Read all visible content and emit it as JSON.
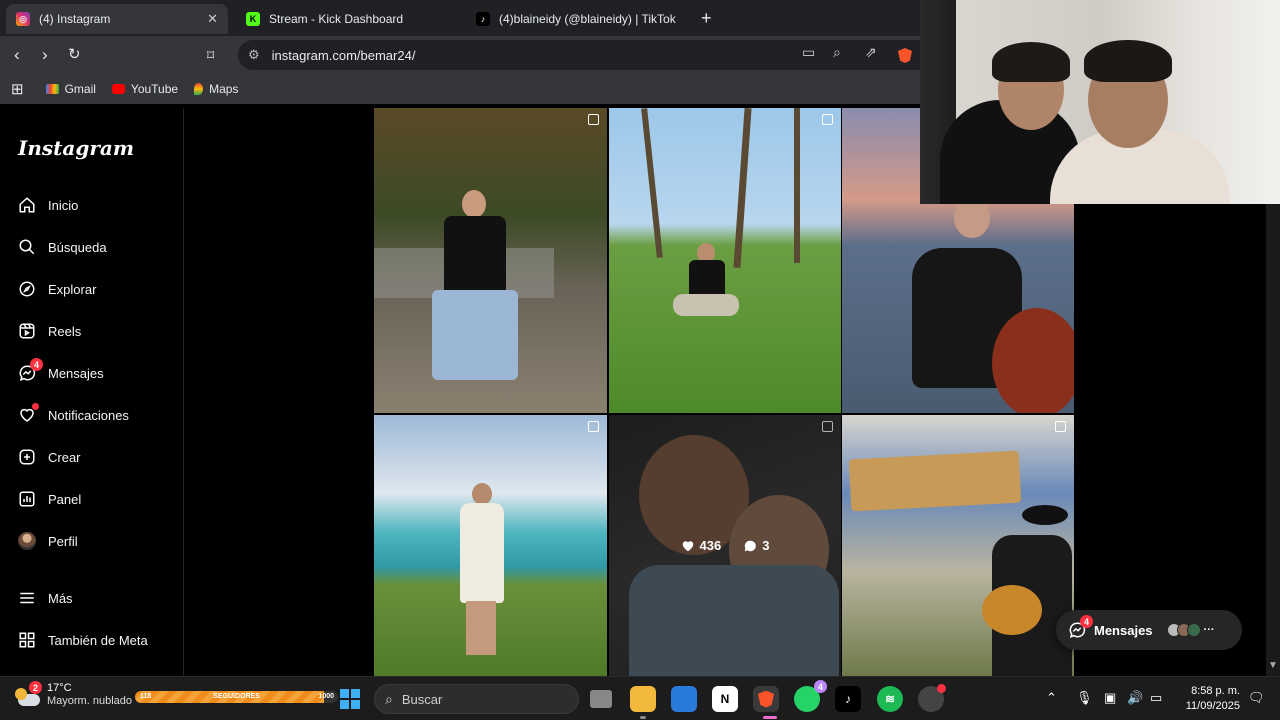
{
  "browser": {
    "tabs": [
      {
        "title": "(4) Instagram",
        "icon": "instagram-icon",
        "active": true
      },
      {
        "title": "Stream - Kick Dashboard",
        "icon": "kick-icon",
        "active": false
      },
      {
        "title": "(4)blaineidy (@blaineidy) | TikTok",
        "icon": "tiktok-icon",
        "active": false
      }
    ],
    "url": "instagram.com/bemar24/",
    "bookmarks": [
      {
        "label": "Gmail",
        "icon": "gmail-icon"
      },
      {
        "label": "YouTube",
        "icon": "youtube-icon"
      },
      {
        "label": "Maps",
        "icon": "maps-icon"
      }
    ]
  },
  "instagram": {
    "logo": "Instagram",
    "nav": [
      {
        "label": "Inicio",
        "icon": "home-icon"
      },
      {
        "label": "Búsqueda",
        "icon": "search-icon"
      },
      {
        "label": "Explorar",
        "icon": "compass-icon"
      },
      {
        "label": "Reels",
        "icon": "reels-icon"
      },
      {
        "label": "Mensajes",
        "icon": "messenger-icon",
        "badge": "4"
      },
      {
        "label": "Notificaciones",
        "icon": "heart-icon"
      },
      {
        "label": "Crear",
        "icon": "plus-square-icon"
      },
      {
        "label": "Panel",
        "icon": "chart-icon"
      },
      {
        "label": "Perfil",
        "icon": "avatar-icon"
      },
      {
        "label": "Más",
        "icon": "menu-icon"
      },
      {
        "label": "También de Meta",
        "icon": "meta-icon"
      }
    ],
    "hover_post": {
      "likes": "436",
      "comments": "3"
    },
    "messages_pill": {
      "label": "Mensajes",
      "badge": "4"
    }
  },
  "taskbar": {
    "weather_badge": "2",
    "temperature": "17°C",
    "weather_desc": "Mayorm. nublado",
    "followers": {
      "start": "118",
      "label": "SEGUIDORES",
      "goal": "1000",
      "progress": 0.93
    },
    "search_placeholder": "Buscar",
    "whatsapp_badge": "4",
    "time": "8:58 p. m.",
    "date": "11/09/2025"
  },
  "colors": {
    "accent": "#ff3040",
    "taskbar": "#1c1c1c",
    "chrome": "#35363a",
    "follow": "#f08c1c"
  }
}
